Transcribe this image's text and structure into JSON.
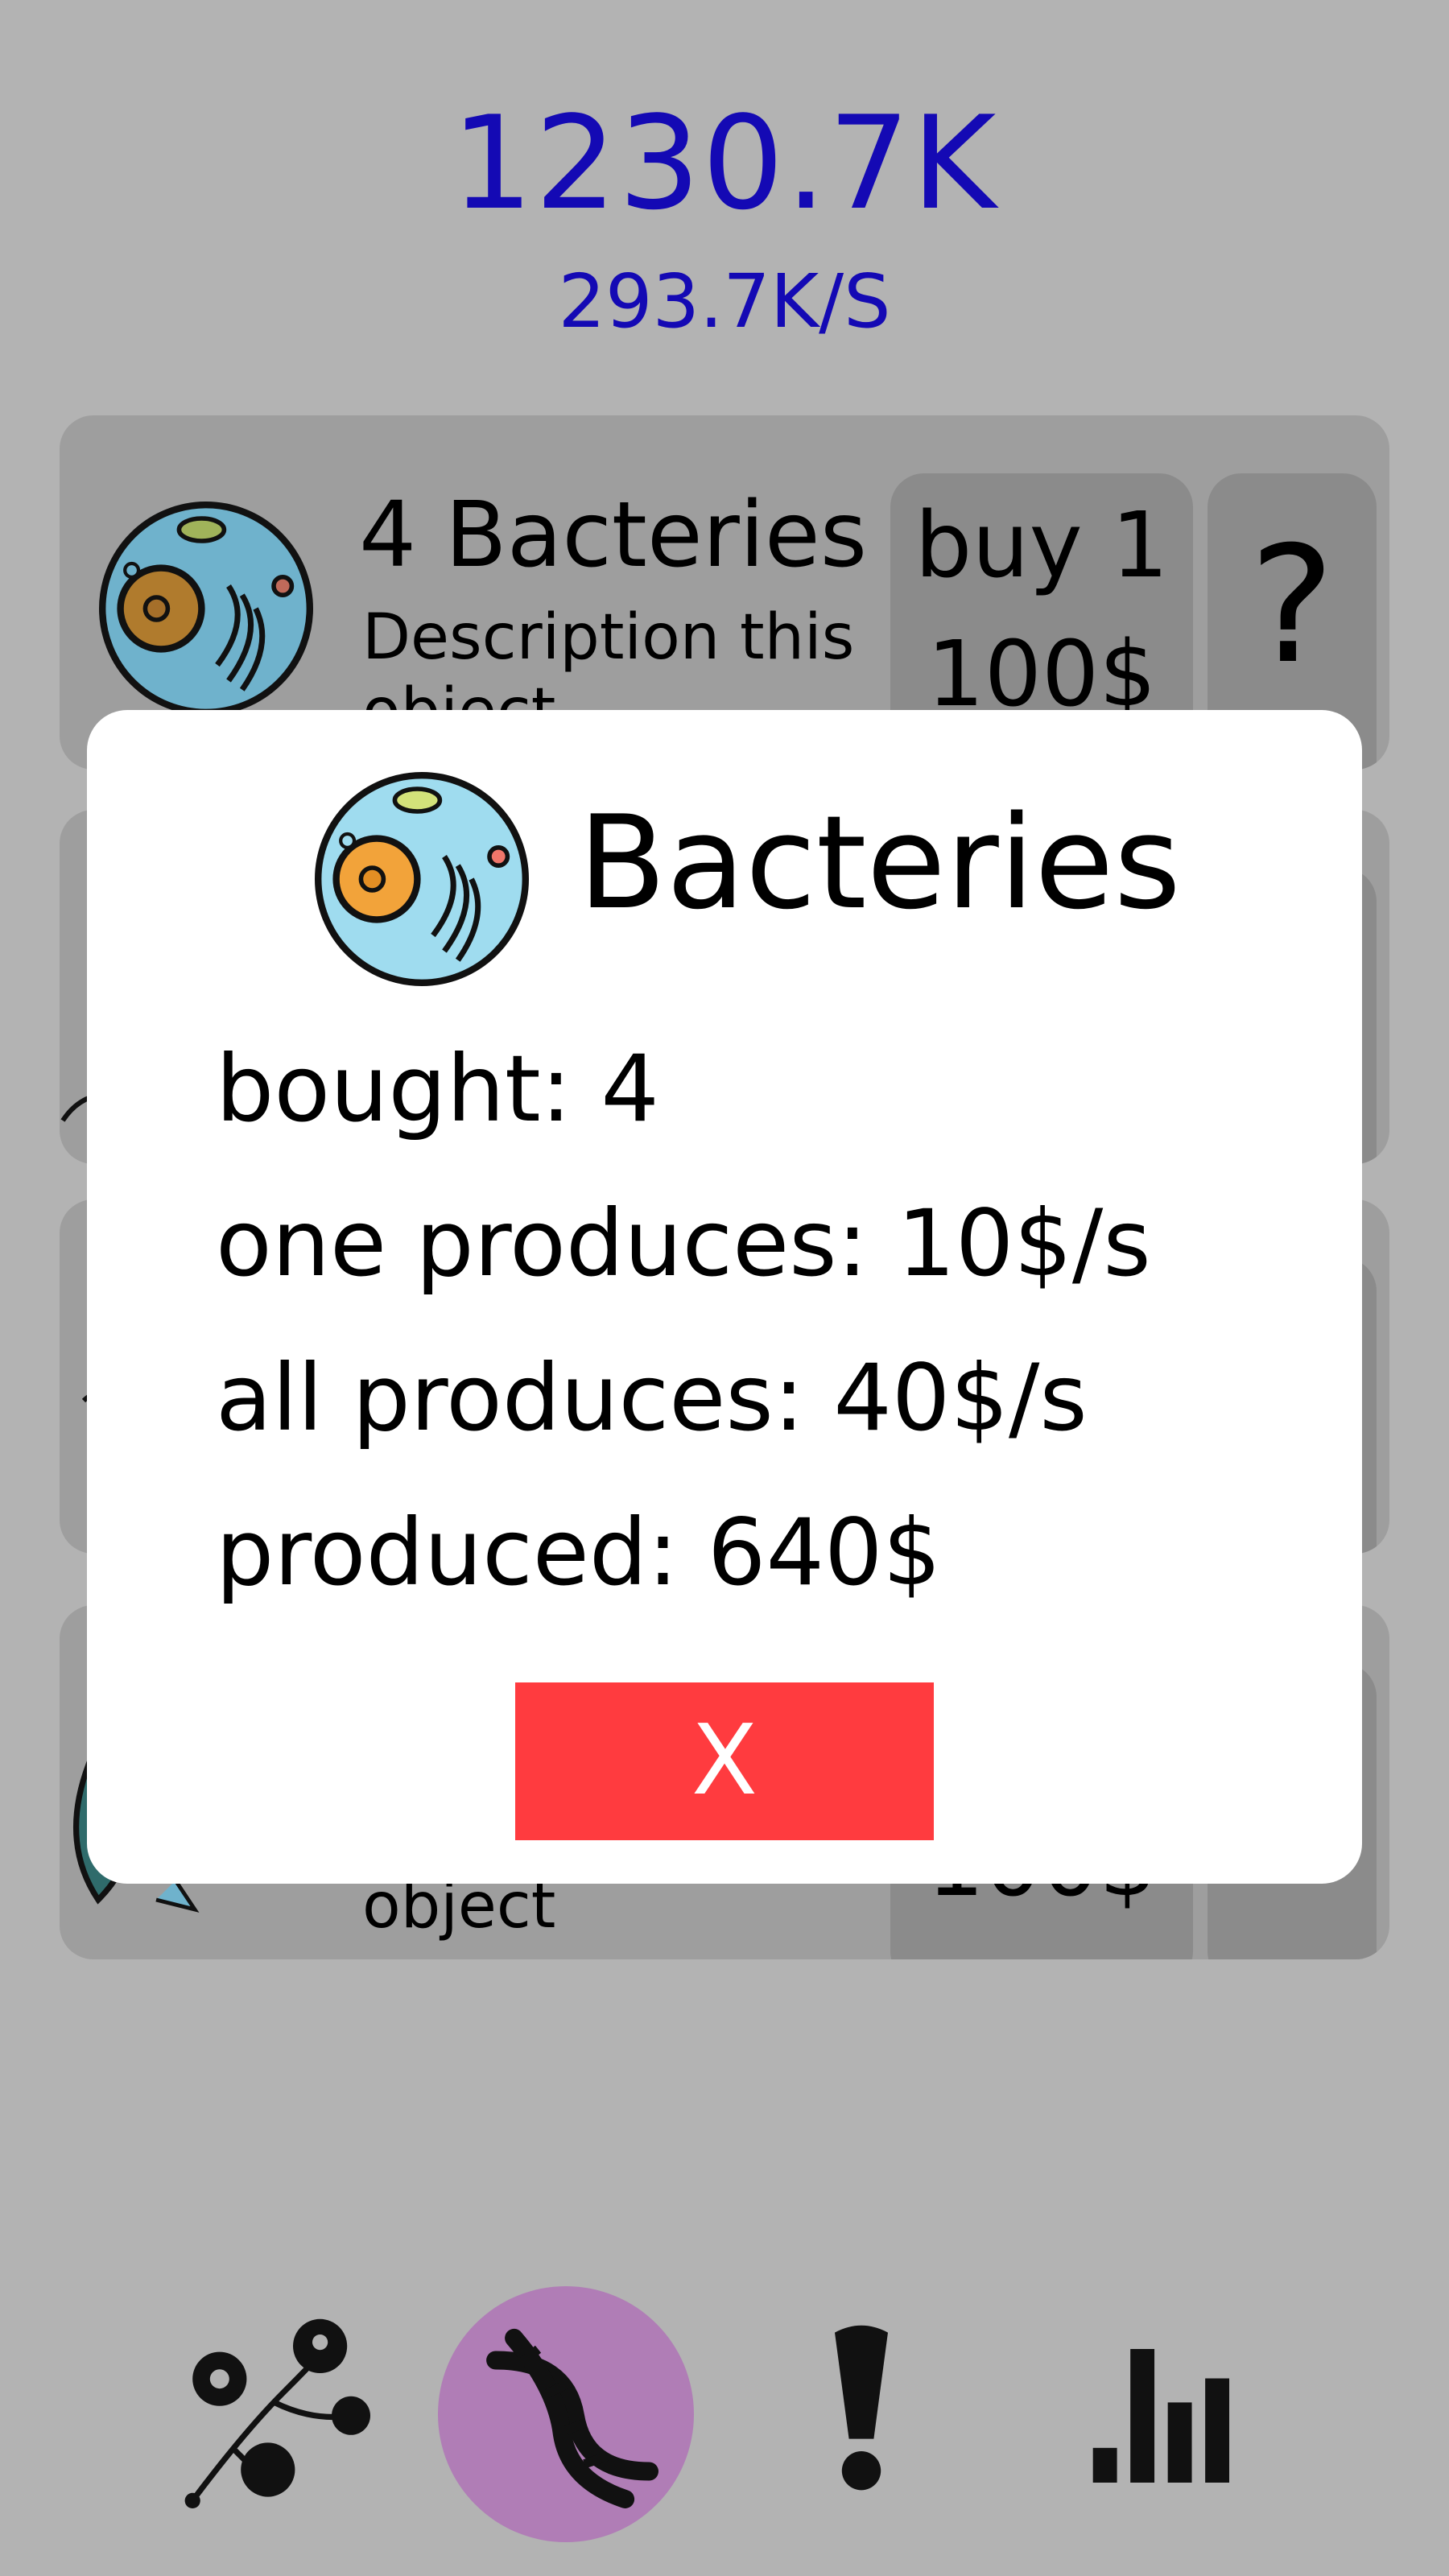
{
  "header": {
    "money": "1230.7K",
    "rate": "293.7K/S"
  },
  "items": [
    {
      "title": "4 Bacteries",
      "description": "Description this object",
      "buy_label": "buy 1",
      "price": "100$",
      "help_label": "?"
    },
    {
      "description": "object",
      "price": "100$"
    }
  ],
  "modal": {
    "title": "Bacteries",
    "bought": "bought: 4",
    "one_produces": "one produces: 10$/s",
    "all_produces": "all produces: 40$/s",
    "produced": "produced: 640$",
    "close_label": "X"
  },
  "nav": {
    "items": [
      "evolution-tree-icon",
      "dna-icon",
      "exclamation-icon",
      "stats-icon"
    ],
    "active_color": "#b07db6"
  },
  "colors": {
    "accent": "#1409b4",
    "close": "#ff3b3f"
  }
}
